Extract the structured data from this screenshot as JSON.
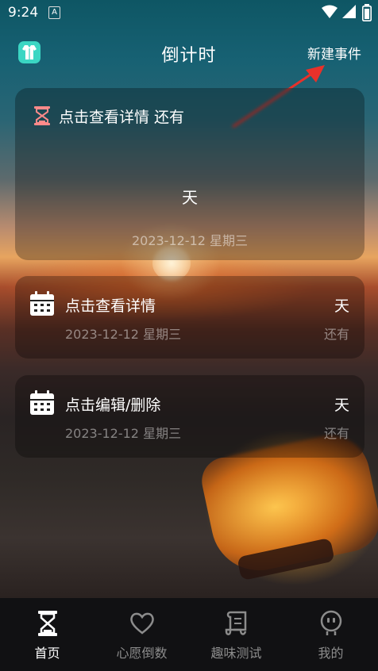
{
  "status_bar": {
    "time": "9:24",
    "notification_badge": "A"
  },
  "header": {
    "title": "倒计时",
    "new_event_label": "新建事件"
  },
  "main_card": {
    "title": "点击查看详情 还有",
    "days_unit": "天",
    "date": "2023-12-12 星期三"
  },
  "events": [
    {
      "title": "点击查看详情",
      "days_unit": "天",
      "date": "2023-12-12 星期三",
      "remain_label": "还有"
    },
    {
      "title": "点击编辑/删除",
      "days_unit": "天",
      "date": "2023-12-12 星期三",
      "remain_label": "还有"
    }
  ],
  "bottom_nav": {
    "items": [
      {
        "label": "首页",
        "icon": "hourglass-icon",
        "active": true
      },
      {
        "label": "心愿倒数",
        "icon": "heart-icon",
        "active": false
      },
      {
        "label": "趣味测试",
        "icon": "scroll-icon",
        "active": false
      },
      {
        "label": "我的",
        "icon": "profile-face-icon",
        "active": false
      }
    ]
  },
  "colors": {
    "accent": "#3bd6c3",
    "hourglass": "#ff8a8a",
    "annotation_arrow": "#e8312a"
  }
}
